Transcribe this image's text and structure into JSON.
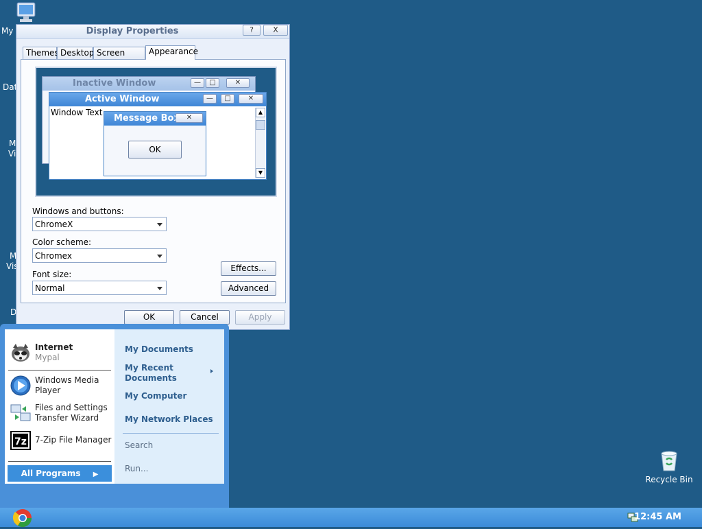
{
  "desktop": {
    "icon_labels": [
      "My",
      "Dat",
      "M",
      "Vi",
      "M",
      "Vis",
      "D"
    ],
    "recycle_bin": "Recycle Bin"
  },
  "dialog": {
    "title": "Display Properties",
    "help_btn": "?",
    "close_btn": "X",
    "tabs": [
      "Themes",
      "Desktop",
      "Screen Saver",
      "Appearance"
    ],
    "active_tab": "Appearance",
    "preview": {
      "inactive_title": "Inactive Window",
      "active_title": "Active Window",
      "window_text": "Window Text",
      "message_title": "Message Box",
      "message_ok": "OK"
    },
    "windows_buttons_label": "Windows and buttons:",
    "windows_buttons_value": "ChromeX",
    "color_scheme_label": "Color scheme:",
    "color_scheme_value": "Chromex",
    "font_size_label": "Font size:",
    "font_size_value": "Normal",
    "effects_btn": "Effects...",
    "advanced_btn": "Advanced",
    "ok_btn": "OK",
    "cancel_btn": "Cancel",
    "apply_btn": "Apply"
  },
  "start_menu": {
    "pinned": [
      {
        "title": "Internet",
        "subtitle": "Mypal"
      }
    ],
    "recent": [
      {
        "title": "Windows Media Player"
      },
      {
        "title": "Files and Settings Transfer Wizard"
      },
      {
        "title": "7-Zip File Manager"
      }
    ],
    "all_programs": "All Programs",
    "right": {
      "my_documents": "My Documents",
      "my_recent": "My Recent Documents",
      "my_computer": "My Computer",
      "my_network": "My Network Places",
      "search": "Search",
      "run": "Run..."
    }
  },
  "taskbar": {
    "clock": "12:45 AM"
  }
}
